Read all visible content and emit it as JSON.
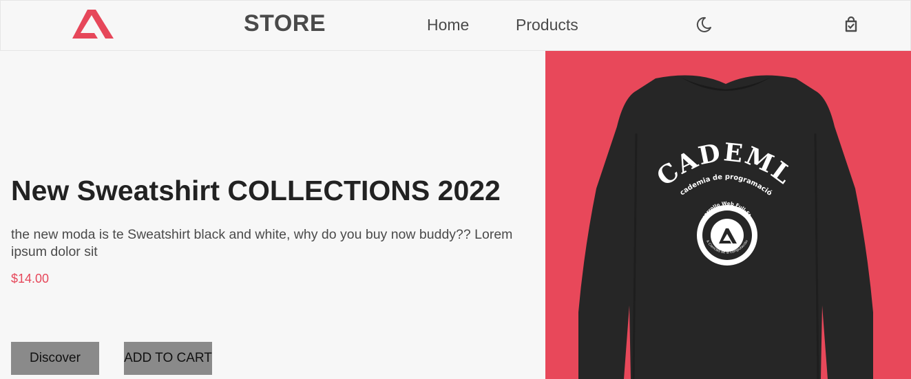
{
  "header": {
    "logo_icon": "academlo-logo-icon",
    "store_title": "STORE",
    "nav": {
      "home": "Home",
      "products": "Products"
    },
    "theme_icon": "moon-icon",
    "cart_icon": "shopping-bag-icon"
  },
  "hero": {
    "title": "New Sweatshirt COLLECTIONS 2022",
    "description": "the new moda is te Sweatshirt black and white, why do you buy now buddy?? Lorem ipsum dolor sit",
    "price": "$14.00",
    "discover_label": "Discover",
    "add_to_cart_label": "ADD TO CART",
    "image": {
      "background_color": "#e8485a",
      "print_main": "ACADEMLO",
      "print_sub": "Academia de programación",
      "badge_top": "Desarrollo Web Full-Stack",
      "badge_bottom": "A Ciencias de la computación"
    }
  },
  "colors": {
    "accent": "#e6475a",
    "text_dark": "#222222",
    "button_gray": "#8a8a8a"
  }
}
